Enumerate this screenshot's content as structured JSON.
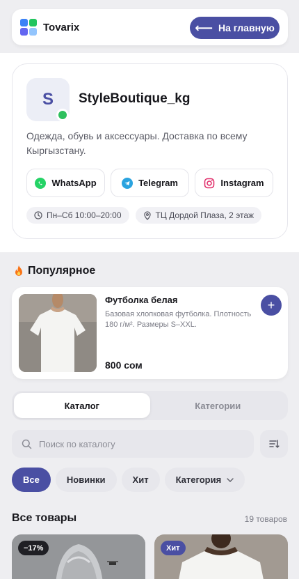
{
  "app": {
    "name": "Tovarix",
    "logo_colors": [
      "#3b82f6",
      "#22c55e",
      "#6366f1",
      "#93c5fd"
    ]
  },
  "header": {
    "home_label": "На главную"
  },
  "shop": {
    "initial": "S",
    "name": "StyleBoutique_kg",
    "description": "Одежда, обувь и аксессуары. Доставка по всему Кыргызстану.",
    "socials": [
      {
        "label": "WhatsApp",
        "icon": "whatsapp-icon",
        "color": "#25d366"
      },
      {
        "label": "Telegram",
        "icon": "telegram-icon",
        "color": "#2aa3df"
      },
      {
        "label": "Instagram",
        "icon": "instagram-icon",
        "color": "#e1306c"
      }
    ],
    "hours": "Пн–Сб 10:00–20:00",
    "address": "ТЦ Дордой Плаза, 2 этаж"
  },
  "popular": {
    "title": "Популярное",
    "item": {
      "name": "Футболка белая",
      "description": "Базовая хлопковая футболка. Плотность 180 г/м². Размеры S–XXL.",
      "price": "800 сом"
    }
  },
  "tabs": [
    {
      "label": "Каталог",
      "active": true
    },
    {
      "label": "Категории",
      "active": false
    }
  ],
  "search": {
    "placeholder": "Поиск по каталогу",
    "value": ""
  },
  "filters": [
    {
      "label": "Все",
      "active": true
    },
    {
      "label": "Новинки",
      "active": false
    },
    {
      "label": "Хит",
      "active": false
    },
    {
      "label": "Категория",
      "active": false,
      "dropdown": true
    }
  ],
  "products": {
    "title": "Все товары",
    "count": "19 товаров",
    "items": [
      {
        "badge": "−17%",
        "badge_color": "#1f1f24"
      },
      {
        "badge": "Хит",
        "badge_color": "#4a4fa3"
      }
    ]
  },
  "colors": {
    "accent": "#4a4fa3",
    "online": "#2ec05e"
  }
}
